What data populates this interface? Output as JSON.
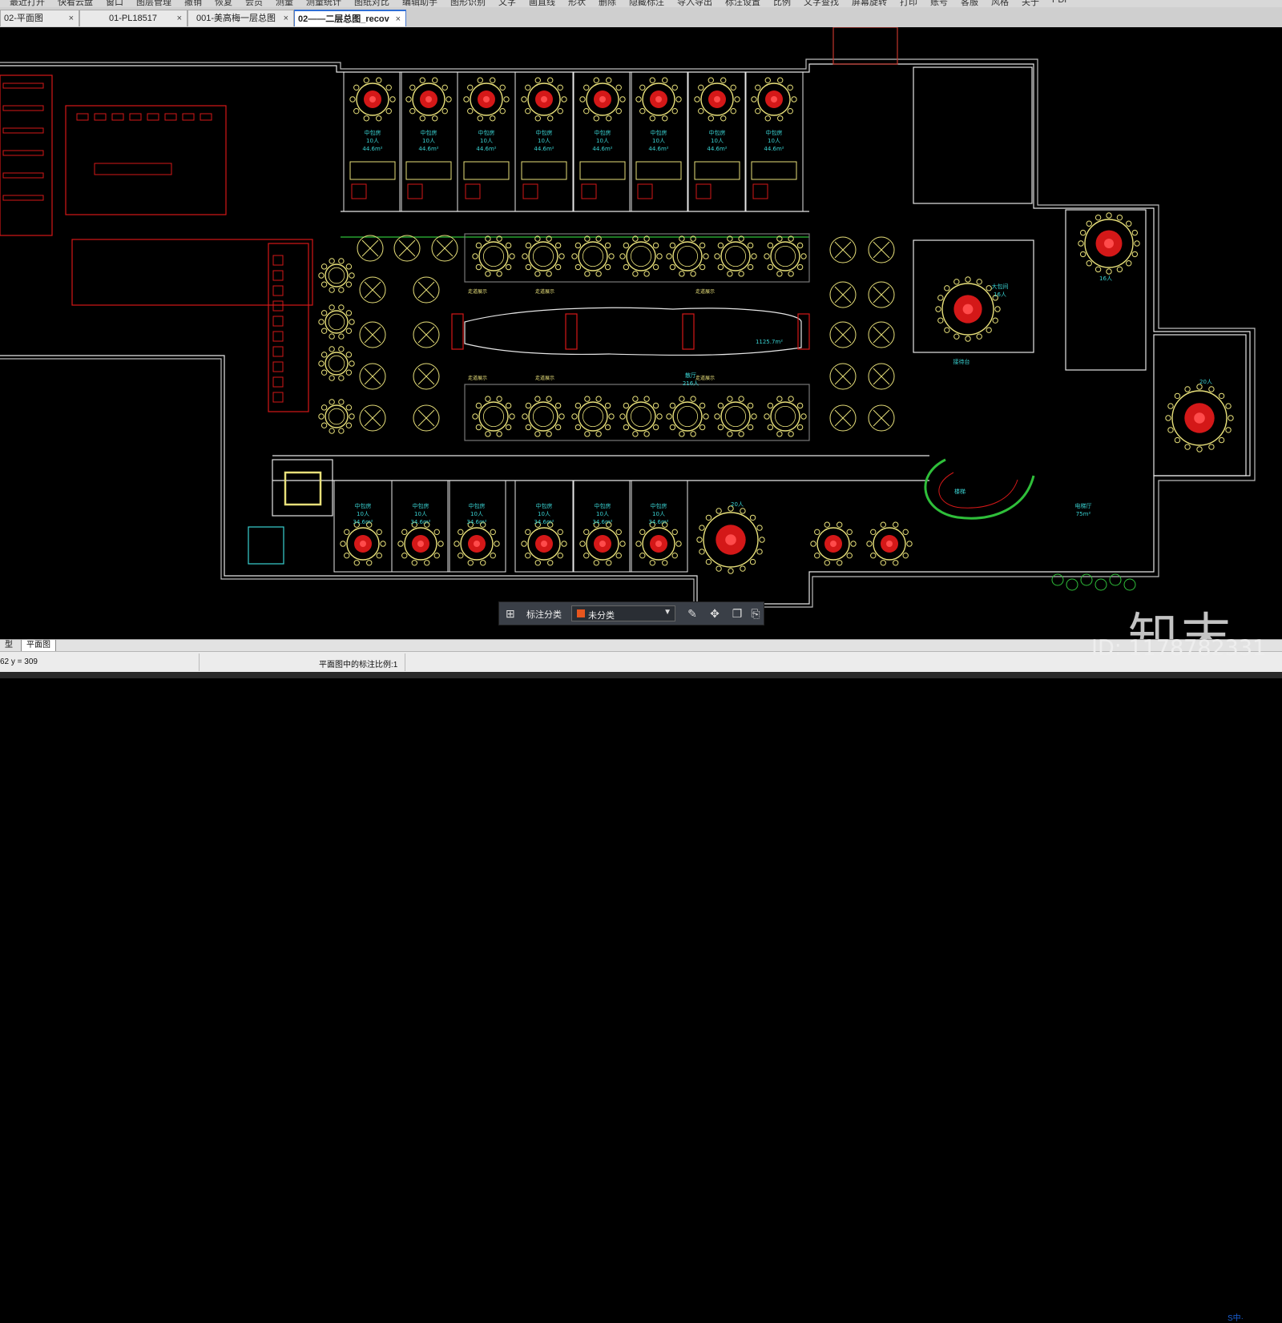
{
  "menu": {
    "items": [
      "最近打开",
      "快看云盘",
      "窗口",
      "图层管理",
      "撤销",
      "恢复",
      "会员",
      "测量",
      "测量统计",
      "图纸对比",
      "编辑助手",
      "图形识别",
      "文字",
      "画直线",
      "形状",
      "删除",
      "隐藏标注",
      "导入导出",
      "标注设置",
      "比例",
      "文字查找",
      "屏幕旋转",
      "打印",
      "账号",
      "客服",
      "风格",
      "关于",
      "PDF"
    ]
  },
  "tabs": [
    {
      "label": "02-平面图",
      "close": "×",
      "active": false
    },
    {
      "label": "01-PL18517",
      "close": "×",
      "active": false
    },
    {
      "label": "001-美高梅一层总图",
      "close": "×",
      "active": false
    },
    {
      "label": "02——二层总图_recov",
      "close": "×",
      "active": true
    }
  ],
  "drawing": {
    "private_room_label": "中包房",
    "private_room_capacity": "10人",
    "private_room_area": "44.6m²",
    "lower_room_area": "34.6m²",
    "hall_name": "散厅",
    "hall_capacity": "216人",
    "hall_area": "1125.7m²",
    "large_room_name": "大包间",
    "large_room_capacity": "16人",
    "xlarge_room_capacity": "20人",
    "corridor_label": "走道展示",
    "stair_label": "楼梯",
    "elevator_hall": "电梯厅",
    "elevator_area": "75m²",
    "reception_label": "接待台"
  },
  "floatbar": {
    "label": "标注分类",
    "selected": "未分类",
    "swatch_color": "#e8561e",
    "icons": [
      "grid-icon",
      "edit-icon",
      "move-icon",
      "copy-icon",
      "paste-icon"
    ]
  },
  "bottom_tabs": [
    {
      "label": "型",
      "active": false
    },
    {
      "label": "平面图",
      "active": true
    }
  ],
  "status": {
    "coordinates": "62 y = 309",
    "scale_text": "平面图中的标注比例:1"
  },
  "watermark": {
    "brand": "知末",
    "id": "ID: 1178782331"
  },
  "tray": {
    "ime": "S中·"
  },
  "colors": {
    "wall": "#e6e6e6",
    "furniture": "#e8e07a",
    "red_area": "#d41818",
    "cyan_text": "#39d1d1",
    "green_line": "#2fbf3a"
  }
}
